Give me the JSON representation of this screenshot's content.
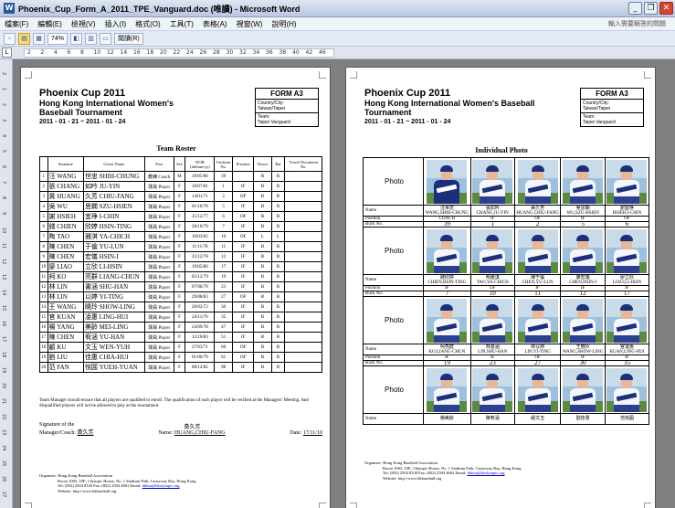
{
  "window": {
    "title": "Phoenix_Cup_Form_A_2011_TPE_Vanguard.doc (唯讀) - Microsoft Word",
    "app_icon": "W",
    "min": "_",
    "restore": "❐",
    "close": "✕"
  },
  "menu": {
    "items": [
      "檔案(F)",
      "編輯(E)",
      "檢視(V)",
      "插入(I)",
      "格式(O)",
      "工具(T)",
      "表格(A)",
      "視窗(W)",
      "說明(H)"
    ],
    "help_placeholder": "輸入需要解答的問題"
  },
  "toolbar": {
    "zoom": "74%",
    "read_label": "閱讀(R)"
  },
  "ruler": {
    "numbers": [
      "2",
      "2",
      "4",
      "6",
      "8",
      "10",
      "12",
      "14",
      "16",
      "18",
      "20",
      "22",
      "24",
      "26",
      "28",
      "30",
      "32",
      "34",
      "36",
      "38",
      "40",
      "42",
      "46"
    ],
    "vnumbers": [
      "2",
      "1",
      "2",
      "3",
      "4",
      "5",
      "6",
      "7",
      "8",
      "9",
      "10",
      "11",
      "12",
      "13",
      "14",
      "15",
      "16",
      "17",
      "18",
      "19",
      "20",
      "21",
      "22",
      "23",
      "24",
      "25",
      "26",
      "27"
    ]
  },
  "page1": {
    "title": "Phoenix Cup 2011",
    "subtitle": "Hong Kong International Women's Baseball Tournament",
    "dates": "2011 - 01 - 21 ~ 2011 - 01 - 24",
    "form": {
      "name": "FORM A3",
      "country_label": "Country/City:",
      "country": "Taiwan/Taipei",
      "team_label": "Team:",
      "team": "Taipei Vanguard"
    },
    "section": "Team Roster",
    "headers": [
      "",
      "Surname",
      "Given Name",
      "Post",
      "Sex",
      "DOB (dd/mm/yy)",
      "Uniform No.",
      "Position",
      "Throw",
      "Bat",
      "Travel Document No."
    ],
    "rows": [
      [
        "1",
        "汪 WANG",
        "世忠 SHIH-CHUNG",
        "教練 Coach",
        "M",
        "19/05/80",
        "39",
        "",
        "R",
        "R",
        ""
      ],
      [
        "2",
        "張 CHANG",
        "如吟 JU-YIN",
        "球員 Player",
        "F",
        "10/07/81",
        "1",
        "IF",
        "R",
        "R",
        ""
      ],
      [
        "3",
        "黃 HUANG",
        "久芳 CHIU-FANG",
        "球員 Player",
        "F",
        "14/01/71",
        "2",
        "OF",
        "R",
        "R",
        ""
      ],
      [
        "4",
        "吳 WU",
        "思嫻 SZU-HSIEN",
        "球員 Player",
        "F",
        "01/10/78",
        "5",
        "IF",
        "R",
        "R",
        ""
      ],
      [
        "5",
        "謝 HSIEH",
        "宜琤 I-CHIN",
        "球員 Player",
        "F",
        "25/12/77",
        "6",
        "OF",
        "R",
        "R",
        ""
      ],
      [
        "6",
        "錢 CHIEN",
        "欣婷 HSIN-TING",
        "球員 Player",
        "F",
        "28/10/79",
        "7",
        "IF",
        "R",
        "R",
        ""
      ],
      [
        "7",
        "陶 TAO",
        "雅淇 YA-CHICH",
        "球員 Player",
        "F",
        "10/03/83",
        "10",
        "OF",
        "L",
        "L",
        ""
      ],
      [
        "8",
        "陳 CHEN",
        "于倫 YU-LUN",
        "球員 Player",
        "F",
        "11/11/78",
        "11",
        "IF",
        "R",
        "R",
        ""
      ],
      [
        "9",
        "陳 CHEN",
        "宏儀 HSIN-I",
        "球員 Player",
        "F",
        "22/12/78",
        "12",
        "IF",
        "R",
        "R",
        ""
      ],
      [
        "10",
        "廖 LIAO",
        "立欣 LI-HSIN",
        "球員 Player",
        "F",
        "19/05/80",
        "17",
        "IF",
        "R",
        "R",
        ""
      ],
      [
        "11",
        "柯 KO",
        "亮群 LIANG-CHUN",
        "球員 Player",
        "F",
        "05/12/79",
        "19",
        "IF",
        "R",
        "R",
        ""
      ],
      [
        "12",
        "林 LIN",
        "書涵 SHU-HAN",
        "球員 Player",
        "F",
        "07/06/79",
        "23",
        "IF",
        "R",
        "R",
        ""
      ],
      [
        "13",
        "林 LIN",
        "以婷 YI-TING",
        "球員 Player",
        "F",
        "29/08/83",
        "27",
        "OF",
        "R",
        "R",
        ""
      ],
      [
        "14",
        "王 WANG",
        "曉玲 SHOW-LING",
        "球員 Player",
        "F",
        "20/02/72",
        "30",
        "IF",
        "R",
        "R",
        ""
      ],
      [
        "15",
        "官 KUAN",
        "凌惠 LING-HUI",
        "球員 Player",
        "F",
        "24/11/76",
        "35",
        "IF",
        "R",
        "R",
        ""
      ],
      [
        "16",
        "楊 YANG",
        "美齡 MEI-LING",
        "球員 Player",
        "F",
        "24/09/78",
        "47",
        "IF",
        "R",
        "R",
        ""
      ],
      [
        "17",
        "陳 CHEN",
        "宥涵 YU-HAN",
        "球員 Player",
        "F",
        "12/10/83",
        "51",
        "IF",
        "R",
        "R",
        ""
      ],
      [
        "18",
        "顧 KU",
        "文玉 WEN-YUH",
        "球員 Player",
        "F",
        "27/03/71",
        "60",
        "OF",
        "R",
        "R",
        ""
      ],
      [
        "19",
        "劉 LIU",
        "佳惠 CHIA-HUI",
        "球員 Player",
        "F",
        "01/06/79",
        "61",
        "OF",
        "R",
        "R",
        ""
      ],
      [
        "20",
        "范 FAN",
        "悅圓 YUEH-YUAN",
        "球員 Player",
        "F",
        "08/12/82",
        "98",
        "IF",
        "R",
        "R",
        ""
      ]
    ],
    "note": "Team Manager should ensure that all players are qualified to enroll. The qualification of each player will be verified at the Managers' Meeting. And disqualified players will not be allowed to play at the tournament.",
    "sig_label1": "Signature of the",
    "sig_label2": "Manager/Coach:",
    "sig_value": "黃久芳",
    "name_label": "Name:",
    "name_cn": "黃久芳",
    "name_value": "HUANG,CHIU-FANG",
    "date_label": "Date:",
    "date_value": "17/11/10",
    "org": {
      "l1": "Organizer: Hong Kong Baseball Association",
      "l2": "Room 1003, 10F., Olympic House, No. 1 Stadium Path, Causeway Bay, Hong Kong",
      "l3a": "Tel: (852) 2504 8330    Fax: (852) 2504 4663 Email:",
      "email": "hkbsa@hkolympic.org",
      "l4": "Website: http://www.hkbaseball.org"
    }
  },
  "page2": {
    "title": "Phoenix Cup 2011",
    "subtitle": "Hong Kong International Women's Baseball Tournament",
    "dates": "2011 - 01 - 21 ~ 2011 - 01 - 24",
    "form": {
      "name": "FORM A3",
      "country_label": "Country/City:",
      "country": "Taiwan/Taipei",
      "team_label": "Team:",
      "team": "Taipei Vanguard"
    },
    "section": "Individual Photo",
    "labels": {
      "photo": "Photo",
      "name": "Name",
      "position": "Position",
      "buck": "Buck No."
    },
    "groups": [
      {
        "players": [
          {
            "cn": "汪世忠",
            "en": "WANG,SHIH-CHUNG",
            "pos": "COACH",
            "no": "39",
            "coach": true
          },
          {
            "cn": "張如吟",
            "en": "CHANG,JU-YIN",
            "pos": "IF",
            "no": "1"
          },
          {
            "cn": "黃久芳",
            "en": "HUANG,CHIU-FANG",
            "pos": "OF",
            "no": "2"
          },
          {
            "cn": "吳思嫻",
            "en": "WU,SZU-HSIEN",
            "pos": "IF",
            "no": "5"
          },
          {
            "cn": "謝宜琤",
            "en": "HSIEH,I-CHIN",
            "pos": "OF",
            "no": "6"
          }
        ]
      },
      {
        "players": [
          {
            "cn": "錢欣婷",
            "en": "CHIEN,HSIN-TING",
            "pos": "IF",
            "no": "7"
          },
          {
            "cn": "陶雅淇",
            "en": "TAO,YA-CHICH",
            "pos": "OF",
            "no": "10"
          },
          {
            "cn": "陳于倫",
            "en": "CHEN,YU-LUN",
            "pos": "IF",
            "no": "11"
          },
          {
            "cn": "陳宏儀",
            "en": "CHEN,HSIN-I",
            "pos": "IF",
            "no": "12"
          },
          {
            "cn": "廖立欣",
            "en": "LIAO,LI-HSIN",
            "pos": "IF",
            "no": "17"
          }
        ]
      },
      {
        "players": [
          {
            "cn": "柯亮群",
            "en": "KO,LIANG-CHUN",
            "pos": "IF",
            "no": "19"
          },
          {
            "cn": "林書涵",
            "en": "LIN,SHU-HAN",
            "pos": "IF",
            "no": "23"
          },
          {
            "cn": "林以婷",
            "en": "LIN,YI-TING",
            "pos": "OF",
            "no": "27"
          },
          {
            "cn": "王曉玲",
            "en": "WANG,SHOW-LING",
            "pos": "IF",
            "no": "30"
          },
          {
            "cn": "官凌惠",
            "en": "KUAN,LING-HUI",
            "pos": "IF",
            "no": "35"
          }
        ]
      },
      {
        "players": [
          {
            "cn": "楊美齡",
            "en": "",
            "pos": "",
            "no": ""
          },
          {
            "cn": "陳宥涵",
            "en": "",
            "pos": "",
            "no": ""
          },
          {
            "cn": "顧文玉",
            "en": "",
            "pos": "",
            "no": ""
          },
          {
            "cn": "劉佳惠",
            "en": "",
            "pos": "",
            "no": ""
          },
          {
            "cn": "范悅圓",
            "en": "",
            "pos": "",
            "no": ""
          }
        ]
      }
    ],
    "org": {
      "l1": "Organizer: Hong Kong Baseball Association",
      "l2": "Room 1003, 10F., Olympic House, No. 1 Stadium Path, Causeway Bay, Hong Kong",
      "l3a": "Tel: (852) 2504 8330    Fax: (852) 2504 4663 Email:",
      "email": "hkbsa@hkolympic.org",
      "l4": "Website: http://www.hkbaseball.org"
    }
  },
  "icons": {
    "app": "word-icon",
    "new": "new-document-icon",
    "open": "open-folder-icon",
    "save": "save-icon",
    "print_preview": "print-preview-icon",
    "read": "read-mode-icon"
  }
}
